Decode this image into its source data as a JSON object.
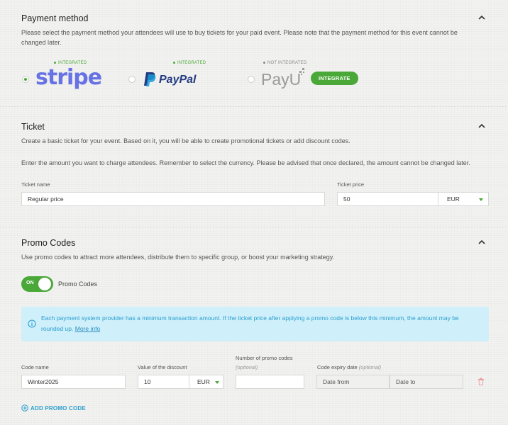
{
  "payment": {
    "title": "Payment method",
    "description": "Please select the payment method your attendees will use to buy tickets for your paid event. Please note that the payment method for this event cannot be changed later.",
    "providers": [
      {
        "name": "stripe",
        "status": "INTEGRATED",
        "selected": true
      },
      {
        "name": "PayPal",
        "status": "INTEGRATED",
        "selected": false
      },
      {
        "name": "PayU",
        "status": "NOT INTEGRATED",
        "selected": false,
        "action_label": "INTEGRATE"
      }
    ]
  },
  "ticket": {
    "title": "Ticket",
    "description_1": "Create a basic ticket for your event. Based on it, you will be able to create promotional tickets or add discount codes.",
    "description_2": "Enter the amount you want to charge attendees. Remember to select the currency. Please be advised that once declared, the amount cannot be changed later.",
    "name_label": "Ticket name",
    "name_value": "Regular price",
    "price_label": "Ticket price",
    "price_value": "50",
    "currency": "EUR"
  },
  "promo": {
    "title": "Promo Codes",
    "description": "Use promo codes to attract more attendees, distribute them to specific group, or boost your marketing strategy.",
    "toggle_state": "ON",
    "toggle_label": "Promo Codes",
    "info_text": "Each payment system provider has a minimum transaction amount. If the ticket price after applying a promo code is below this minimum, the amount may be rounded up.",
    "info_link": "More info",
    "code_name_label": "Code name",
    "code_name_value": "Winter2025",
    "discount_label": "Value of the discount",
    "discount_value": "10",
    "discount_currency": "EUR",
    "count_label": "Number of promo codes",
    "count_optional": "(optional)",
    "count_value": "",
    "expiry_label": "Code expiry date",
    "expiry_optional": "(optional)",
    "date_from": "Date from",
    "date_to": "Date to",
    "add_label": "ADD PROMO CODE"
  },
  "colors": {
    "accent": "#4aa838",
    "info": "#2a9fcf",
    "stripe": "#6772e5",
    "paypal_dark": "#253b80",
    "paypal_light": "#179bd7"
  }
}
